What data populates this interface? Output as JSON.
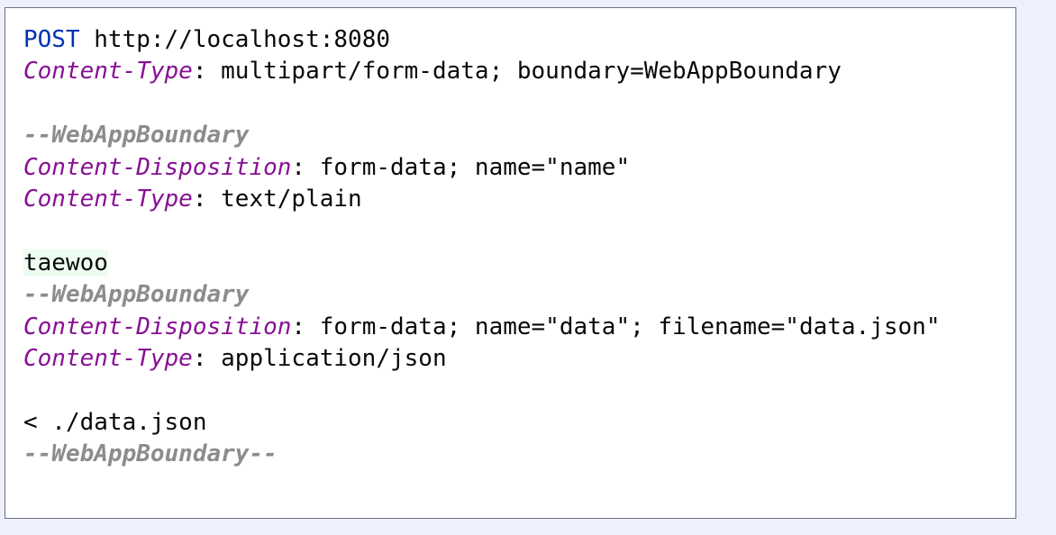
{
  "editor": {
    "line1": {
      "method": "POST",
      "url": " http://localhost:8080"
    },
    "line2": {
      "name": "Content-Type",
      "value": ": multipart/form-data; boundary=WebAppBoundary"
    },
    "line4": {
      "boundary": "--WebAppBoundary"
    },
    "line5": {
      "name": "Content-Disposition",
      "value": ": form-data; name=\"name\""
    },
    "line6": {
      "name": "Content-Type",
      "value": ": text/plain"
    },
    "line8": {
      "text": "taewoo"
    },
    "line9": {
      "boundary": "--WebAppBoundary"
    },
    "line10": {
      "name": "Content-Disposition",
      "value": ": form-data; name=\"data\"; filename=\"data.json\""
    },
    "line11": {
      "name": "Content-Type",
      "value": ": application/json"
    },
    "line13": {
      "text": "< ./data.json"
    },
    "line14": {
      "boundary": "--WebAppBoundary--"
    }
  }
}
